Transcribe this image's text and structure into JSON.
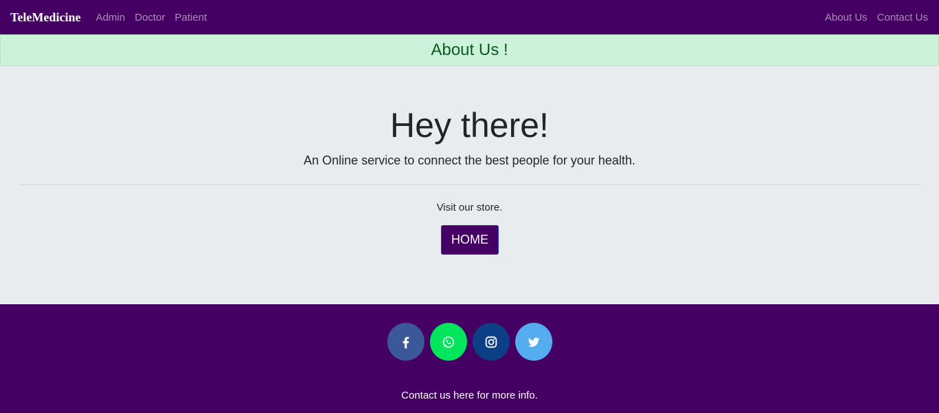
{
  "navbar": {
    "brand": "TeleMedicine",
    "left_links": [
      "Admin",
      "Doctor",
      "Patient"
    ],
    "right_links": [
      "About Us",
      "Contact Us"
    ],
    "background": "#440062"
  },
  "alert": {
    "text": "About Us !",
    "background": "#ccf2da",
    "color": "#0a5c1e"
  },
  "jumbotron": {
    "title": "Hey there!",
    "lead": "An Online service to connect the best people for your health.",
    "visit_text": "Visit our store.",
    "home_button": "HOME"
  },
  "footer": {
    "social": [
      {
        "name": "facebook-icon",
        "color": "#3b5998"
      },
      {
        "name": "whatsapp-icon",
        "color": "#00e65c"
      },
      {
        "name": "instagram-icon",
        "color": "#0d3f86"
      },
      {
        "name": "twitter-icon",
        "color": "#55acee"
      }
    ],
    "contact_text": "Contact us here for more info."
  }
}
